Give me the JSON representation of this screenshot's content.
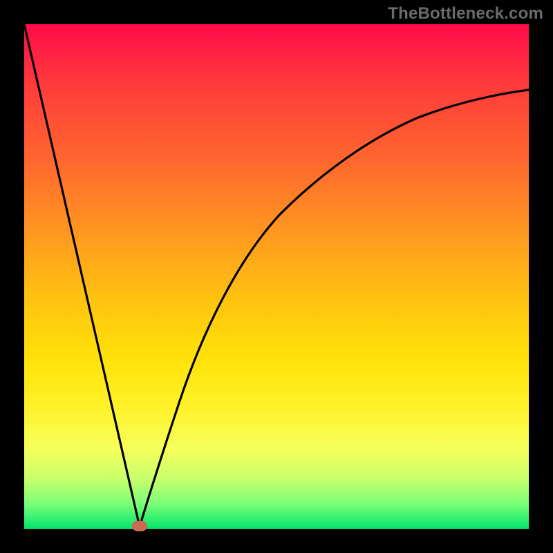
{
  "watermark": "TheBottleneck.com",
  "chart_data": {
    "type": "line",
    "title": "",
    "xlabel": "",
    "ylabel": "",
    "xlim": [
      0,
      100
    ],
    "ylim": [
      0,
      100
    ],
    "x": [
      0,
      2,
      4,
      6,
      8,
      10,
      12,
      14,
      16,
      18,
      20,
      22,
      23,
      24,
      26,
      28,
      30,
      34,
      38,
      42,
      46,
      50,
      55,
      60,
      65,
      70,
      75,
      80,
      85,
      90,
      95,
      100
    ],
    "y": [
      100,
      91,
      83,
      74,
      66,
      57,
      48,
      40,
      31,
      22,
      14,
      5,
      0,
      5,
      14,
      22,
      29,
      40,
      49,
      56,
      61,
      65,
      70,
      73,
      76,
      78,
      80,
      82,
      83,
      84,
      85,
      86
    ],
    "marker": {
      "x": 23,
      "y": 0
    },
    "background_gradient": {
      "top": "#ff0a4a",
      "bottom": "#00e56a"
    }
  }
}
